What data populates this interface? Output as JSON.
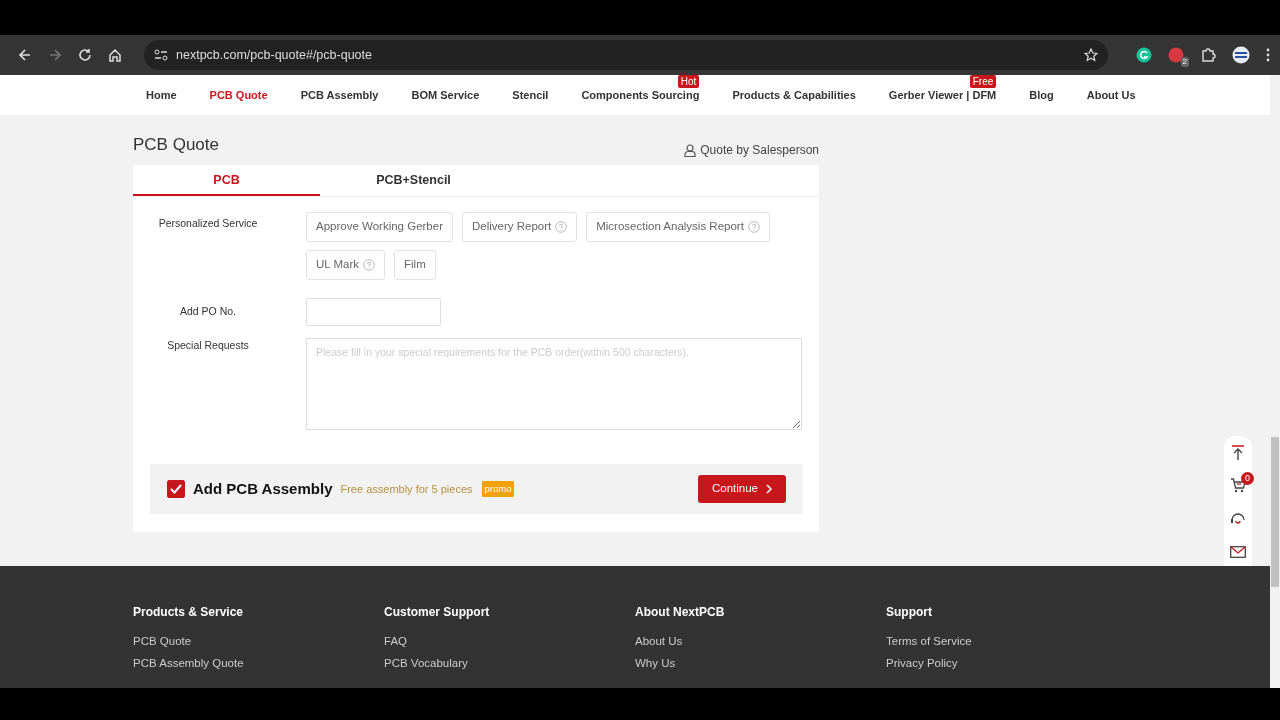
{
  "browser": {
    "url": "nextpcb.com/pcb-quote#/pcb-quote",
    "extension_badge": "2"
  },
  "nav": [
    {
      "label": "Home",
      "selected": false
    },
    {
      "label": "PCB Quote",
      "selected": true
    },
    {
      "label": "PCB Assembly",
      "selected": false
    },
    {
      "label": "BOM Service",
      "selected": false
    },
    {
      "label": "Stencil",
      "selected": false
    },
    {
      "label": "Components Sourcing",
      "selected": false,
      "tag": "Hot"
    },
    {
      "label": "Products & Capabilities",
      "selected": false
    },
    {
      "label": "Gerber Viewer | DFM",
      "selected": false,
      "tag": "Free"
    },
    {
      "label": "Blog",
      "selected": false
    },
    {
      "label": "About Us",
      "selected": false
    }
  ],
  "page_title": "PCB Quote",
  "salesperson_link": "Quote by Salesperson",
  "tabs": [
    {
      "label": "PCB",
      "selected": true
    },
    {
      "label": "PCB+Stencil",
      "selected": false
    }
  ],
  "personalized_service": {
    "label": "Personalized Service",
    "options": [
      {
        "label": "Approve Working Gerber",
        "help": false
      },
      {
        "label": "Delivery Report",
        "help": true
      },
      {
        "label": "Microsection Analysis Report",
        "help": true
      },
      {
        "label": "UL Mark",
        "help": true
      },
      {
        "label": "Film",
        "help": false
      }
    ]
  },
  "po_number": {
    "label": "Add PO No."
  },
  "special_requests": {
    "label": "Special Requests",
    "placeholder": "Please fill in your special requirements for the PCB order(within 500 characters)."
  },
  "assembly": {
    "checked": true,
    "label": "Add PCB Assembly",
    "note": "Free assembly for 5 pieces",
    "promo": "promo",
    "button": "Continue"
  },
  "side_tools": {
    "cart_count": "0"
  },
  "footer": [
    {
      "heading": "Products & Service",
      "links": [
        "PCB Quote",
        "PCB Assembly Quote"
      ]
    },
    {
      "heading": "Customer Support",
      "links": [
        "FAQ",
        "PCB Vocabulary"
      ]
    },
    {
      "heading": "About NextPCB",
      "links": [
        "About Us",
        "Why Us"
      ]
    },
    {
      "heading": "Support",
      "links": [
        "Terms of Service",
        "Privacy Policy"
      ]
    }
  ]
}
